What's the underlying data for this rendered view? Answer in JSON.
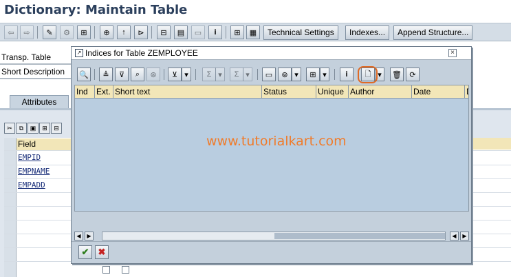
{
  "window": {
    "title": "Dictionary: Maintain Table"
  },
  "toolbar": {
    "technical_settings": "Technical Settings",
    "indexes": "Indexes...",
    "append_structure": "Append Structure..."
  },
  "form": {
    "transp_table_label": "Transp. Table",
    "short_description_label": "Short Description",
    "attributes_tab": "Attributes"
  },
  "fields_grid": {
    "header": "Field",
    "rows": [
      "EMPID",
      "EMPNAME",
      "EMPADD"
    ]
  },
  "dialog": {
    "title": "Indices for Table ZEMPLOYEE",
    "columns": [
      "Ind",
      "Ext.",
      "Short text",
      "Status",
      "Unique",
      "Author",
      "Date",
      "D"
    ]
  },
  "watermark": "www.tutorialkart.com",
  "colors": {
    "accent": "#f07b2a",
    "title_text": "#2b3f5c",
    "table_header": "#f2e6b8"
  }
}
